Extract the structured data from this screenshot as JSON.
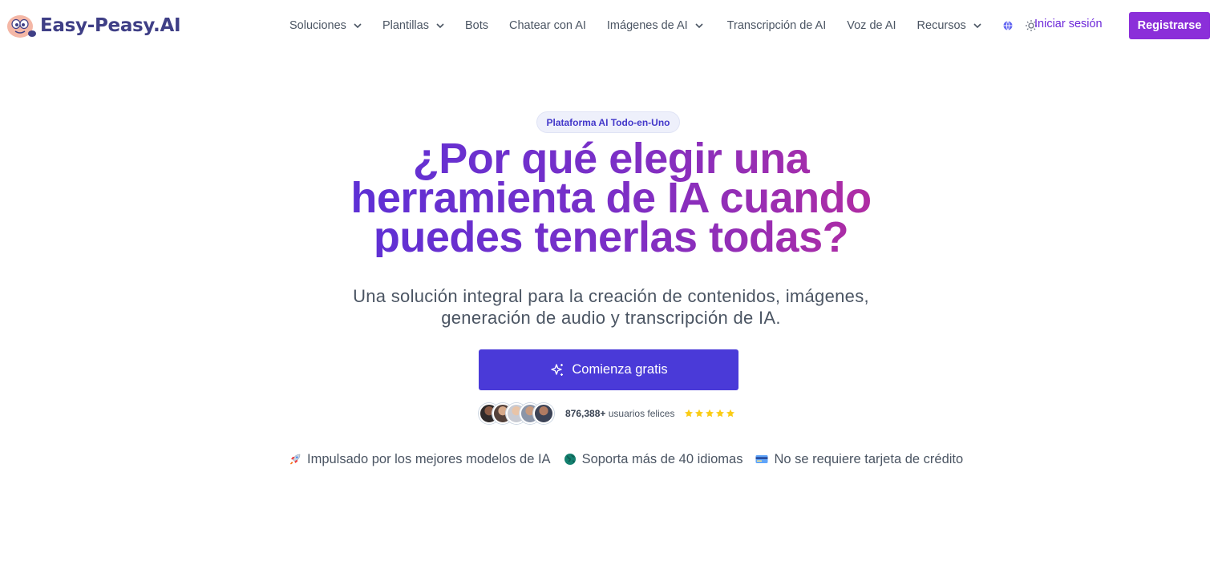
{
  "brand": {
    "name": "Easy-Peasy.AI"
  },
  "nav": {
    "items": [
      {
        "label": "Soluciones",
        "dropdown": true
      },
      {
        "label": "Plantillas",
        "dropdown": true
      },
      {
        "label": "Bots",
        "dropdown": false
      },
      {
        "label": "Chatear con AI",
        "dropdown": false
      },
      {
        "label": "Imágenes de AI",
        "dropdown": true
      },
      {
        "label": "Transcripción de AI",
        "dropdown": false
      },
      {
        "label": "Voz de AI",
        "dropdown": false
      },
      {
        "label": "Recursos",
        "dropdown": true
      }
    ],
    "language_icon": "globe-icon",
    "theme_icon": "sun-icon",
    "login_label": "Iniciar sesión",
    "signup_label": "Registrarse"
  },
  "hero": {
    "badge": "Plataforma AI Todo-en-Uno",
    "title_line1": "¿Por qué elegir una",
    "title_line2": "herramienta de IA cuando",
    "title_line3": "puedes tenerlas todas?",
    "subtitle_line1": "Una solución integral para la creación de contenidos, imágenes,",
    "subtitle_line2": "generación de audio y transcripción de IA.",
    "cta_label": "Comienza gratis",
    "cta_icon": "sparkles-icon",
    "users_count": "876,388+",
    "users_label": "usuarios felices",
    "rating_stars": 5
  },
  "features": [
    {
      "icon": "rocket-icon",
      "label": "Impulsado por los mejores modelos de IA"
    },
    {
      "icon": "globe-earth-icon",
      "label": "Soporta más de 40 idiomas"
    },
    {
      "icon": "credit-card-icon",
      "label": "No se requiere tarjeta de crédito"
    }
  ],
  "colors": {
    "brand_text": "#3f3f86",
    "signup_bg": "#8b2fd9",
    "cta_bg": "#4a3ad8",
    "title_gradient_start": "#5b30d6",
    "title_gradient_end": "#b42ca0",
    "star": "#facc15"
  }
}
